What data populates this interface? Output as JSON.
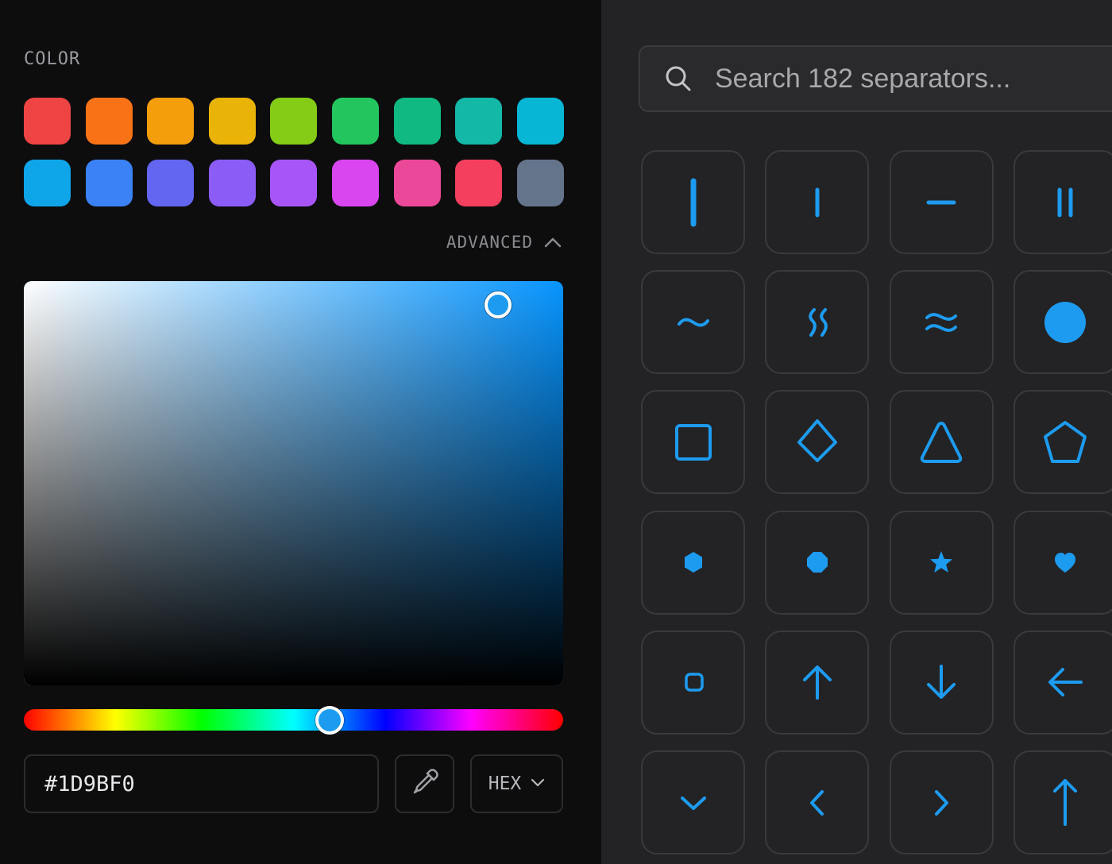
{
  "color_panel": {
    "title": "COLOR",
    "swatches": [
      {
        "name": "red",
        "color": "#ef4444"
      },
      {
        "name": "orange",
        "color": "#f97316"
      },
      {
        "name": "amber",
        "color": "#f59e0b"
      },
      {
        "name": "yellow",
        "color": "#eab308"
      },
      {
        "name": "lime",
        "color": "#84cc16"
      },
      {
        "name": "green",
        "color": "#22c55e"
      },
      {
        "name": "emerald",
        "color": "#10b981"
      },
      {
        "name": "teal",
        "color": "#14b8a6"
      },
      {
        "name": "cyan",
        "color": "#06b6d4"
      },
      {
        "name": "sky",
        "color": "#0ea5e9"
      },
      {
        "name": "blue",
        "color": "#3b82f6"
      },
      {
        "name": "indigo",
        "color": "#6366f1"
      },
      {
        "name": "violet",
        "color": "#8b5cf6"
      },
      {
        "name": "purple",
        "color": "#a855f7"
      },
      {
        "name": "fuchsia",
        "color": "#d946ef"
      },
      {
        "name": "pink",
        "color": "#ec4899"
      },
      {
        "name": "rose",
        "color": "#f43f5e"
      },
      {
        "name": "slate",
        "color": "#64748b"
      }
    ],
    "advanced_label": "ADVANCED",
    "advanced_expanded": true,
    "picker": {
      "hue_color": "#0795ff",
      "current_color": "#1d9bf0",
      "hex_value": "#1D9BF0",
      "format": "HEX"
    }
  },
  "separator_panel": {
    "search_placeholder": "Search 182 separators...",
    "accent_color": "#1d9bf0",
    "tiles": [
      {
        "name": "thick-vertical-bar-icon"
      },
      {
        "name": "thin-vertical-bar-icon"
      },
      {
        "name": "horizontal-dash-icon"
      },
      {
        "name": "double-vertical-bar-icon"
      },
      {
        "name": "tilde-icon"
      },
      {
        "name": "vertical-wave-icon"
      },
      {
        "name": "double-wave-icon"
      },
      {
        "name": "filled-circle-icon"
      },
      {
        "name": "square-outline-icon"
      },
      {
        "name": "diamond-outline-icon"
      },
      {
        "name": "triangle-outline-icon"
      },
      {
        "name": "pentagon-outline-icon"
      },
      {
        "name": "filled-hexagon-icon"
      },
      {
        "name": "filled-octagon-icon"
      },
      {
        "name": "filled-star-icon"
      },
      {
        "name": "filled-heart-icon"
      },
      {
        "name": "small-rounded-square-icon"
      },
      {
        "name": "arrow-up-icon"
      },
      {
        "name": "arrow-down-icon"
      },
      {
        "name": "arrow-left-icon"
      },
      {
        "name": "chevron-down-icon"
      },
      {
        "name": "chevron-left-icon"
      },
      {
        "name": "chevron-right-icon"
      },
      {
        "name": "long-arrow-up-icon"
      }
    ]
  }
}
